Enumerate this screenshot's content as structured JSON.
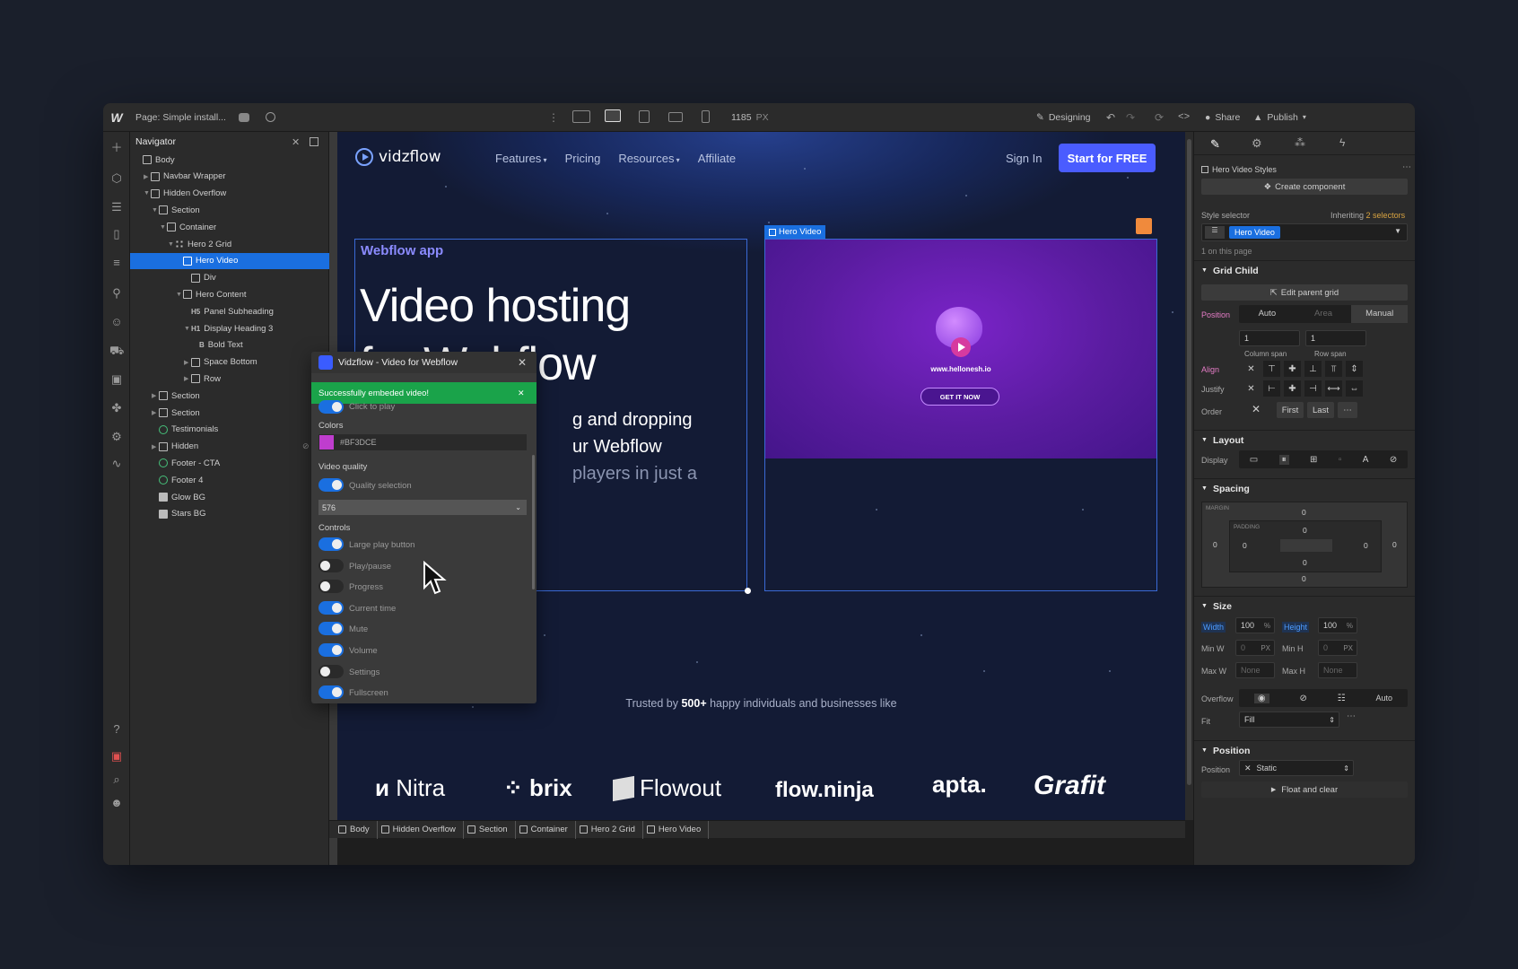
{
  "topbar": {
    "logo": "W",
    "page_label": "Page: Simple install...",
    "width_value": "1185",
    "width_unit": "PX",
    "designing": "Designing",
    "share": "Share",
    "publish": "Publish"
  },
  "navigator": {
    "title": "Navigator",
    "items": [
      {
        "label": "Body",
        "level": 0,
        "type": "box"
      },
      {
        "label": "Navbar Wrapper",
        "level": 1,
        "type": "box"
      },
      {
        "label": "Hidden Overflow",
        "level": 1,
        "type": "box"
      },
      {
        "label": "Section",
        "level": 2,
        "type": "box"
      },
      {
        "label": "Container",
        "level": 3,
        "type": "box"
      },
      {
        "label": "Hero 2 Grid",
        "level": 4,
        "type": "grid"
      },
      {
        "label": "Hero Video",
        "level": 5,
        "type": "box",
        "selected": true
      },
      {
        "label": "Div",
        "level": 6,
        "type": "box"
      },
      {
        "label": "Hero Content",
        "level": 5,
        "type": "box"
      },
      {
        "label": "Panel Subheading",
        "level": 6,
        "type": "h5",
        "prefix": "H5"
      },
      {
        "label": "Display Heading 3",
        "level": 6,
        "type": "h1",
        "prefix": "H1"
      },
      {
        "label": "Bold Text",
        "level": 7,
        "type": "b",
        "prefix": "B"
      },
      {
        "label": "Space Bottom",
        "level": 6,
        "type": "box"
      },
      {
        "label": "Row",
        "level": 6,
        "type": "box"
      },
      {
        "label": "Section",
        "level": 2,
        "type": "box"
      },
      {
        "label": "Section",
        "level": 2,
        "type": "box"
      },
      {
        "label": "Testimonials",
        "level": 2,
        "type": "comp"
      },
      {
        "label": "Hidden",
        "level": 2,
        "type": "box"
      },
      {
        "label": "Footer - CTA",
        "level": 2,
        "type": "comp"
      },
      {
        "label": "Footer 4",
        "level": 2,
        "type": "comp"
      },
      {
        "label": "Glow BG",
        "level": 2,
        "type": "img"
      },
      {
        "label": "Stars BG",
        "level": 2,
        "type": "img"
      }
    ]
  },
  "site": {
    "brand": "vidzflow",
    "nav": [
      "Features",
      "Pricing",
      "Resources",
      "Affiliate"
    ],
    "sign_in": "Sign In",
    "cta": "Start for FREE",
    "eyebrow": "Webflow app",
    "headline_1": "Video hosting",
    "headline_2": "for Webflow",
    "sub_1": "g and dropping",
    "sub_2": "ur Webflow",
    "sub_3": "players in just a",
    "video_tag": "Hero Video",
    "video_url": "www.hellonesh.io",
    "video_button": "GET IT NOW",
    "trusted_pre": "Trusted by ",
    "trusted_bold": "500+",
    "trusted_post": " happy individuals and businesses like",
    "logos": [
      "Nitra",
      "brix",
      "Flowout",
      "flow.ninja",
      "apta.",
      "Grafit"
    ]
  },
  "plugin": {
    "title": "Vidzflow - Video for Webflow",
    "toast": "Successfully embeded video!",
    "click_to_play": "Click to play",
    "colors_label": "Colors",
    "color_value": "#BF3DCE",
    "color_hex": "#bf3dce",
    "quality_label": "Video quality",
    "quality_toggle": "Quality selection",
    "quality_value": "576",
    "controls_label": "Controls",
    "controls": [
      {
        "label": "Large play button",
        "on": true
      },
      {
        "label": "Play/pause",
        "on": false
      },
      {
        "label": "Progress",
        "on": false
      },
      {
        "label": "Current time",
        "on": true
      },
      {
        "label": "Mute",
        "on": true
      },
      {
        "label": "Volume",
        "on": true
      },
      {
        "label": "Settings",
        "on": false
      },
      {
        "label": "Fullscreen",
        "on": true
      }
    ]
  },
  "breadcrumb": [
    "Body",
    "Hidden Overflow",
    "Section",
    "Container",
    "Hero 2 Grid",
    "Hero Video"
  ],
  "style_panel": {
    "styles_title": "Hero Video Styles",
    "create_component": "Create component",
    "style_selector": "Style selector",
    "inheriting": "Inheriting",
    "selectors": "2 selectors",
    "selector_tag": "Hero Video",
    "on_page": "1 on this page",
    "grid_child": "Grid Child",
    "edit_parent_grid": "Edit parent grid",
    "position_label": "Position",
    "pos_options": [
      "Auto",
      "Area",
      "Manual"
    ],
    "column_span_value": "1",
    "row_span_value": "1",
    "column_span": "Column span",
    "row_span": "Row span",
    "align": "Align",
    "justify": "Justify",
    "order": "Order",
    "order_first": "First",
    "order_last": "Last",
    "layout": "Layout",
    "display": "Display",
    "spacing": "Spacing",
    "margin": "MARGIN",
    "padding": "PADDING",
    "zero": "0",
    "size": "Size",
    "width": "Width",
    "width_val": "100",
    "height": "Height",
    "height_val": "100",
    "pct": "%",
    "min_w": "Min W",
    "min_h": "Min H",
    "min_val": "0",
    "px": "PX",
    "max_w": "Max W",
    "max_h": "Max H",
    "none": "None",
    "overflow": "Overflow",
    "overflow_auto": "Auto",
    "fit": "Fit",
    "fit_val": "Fill",
    "position": "Position",
    "position_val": "Static",
    "float_clear": "Float and clear"
  },
  "colors": {
    "accent": "#1a6fe0",
    "cta": "#4a5cff",
    "toast": "#1aa34a",
    "video_bg": "#5a1ca0"
  }
}
